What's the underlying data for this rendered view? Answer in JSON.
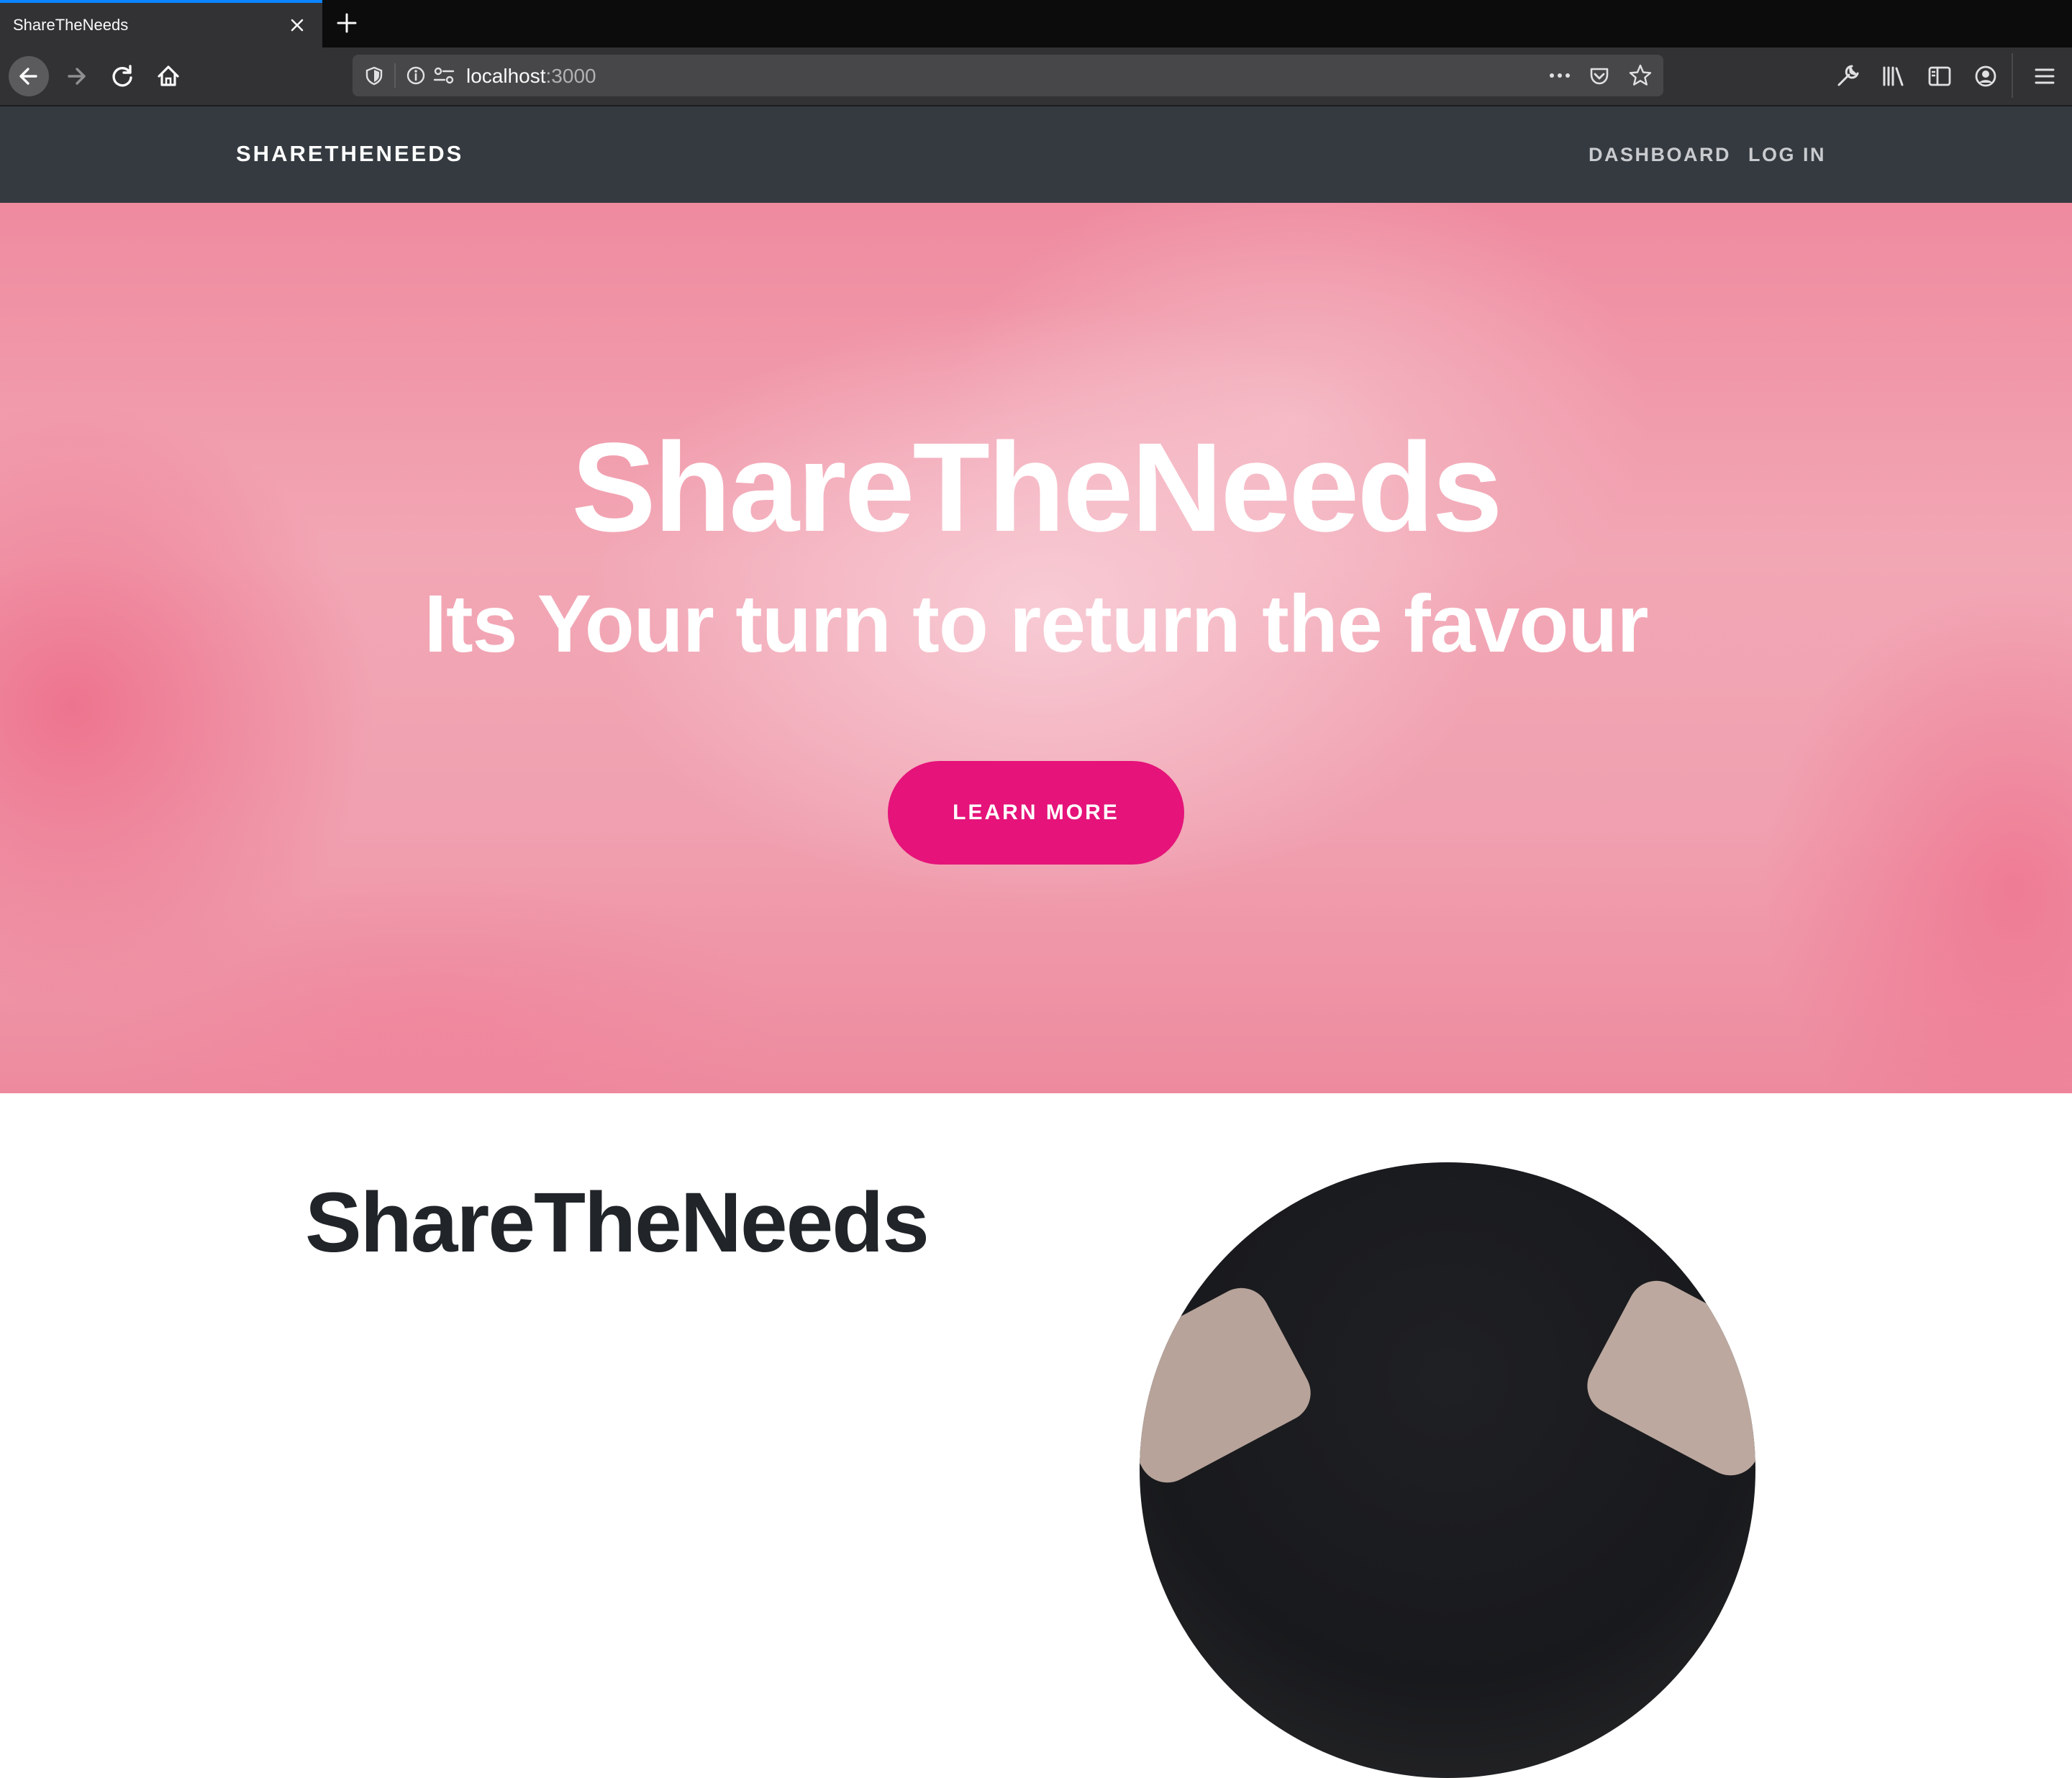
{
  "browser": {
    "tab": {
      "title": "ShareTheNeeds"
    },
    "address": {
      "host": "localhost",
      "port": ":3000"
    }
  },
  "site": {
    "brand": "SHARETHENEEDS",
    "nav": [
      {
        "label": "DASHBOARD"
      },
      {
        "label": "LOG IN"
      }
    ]
  },
  "hero": {
    "title": "ShareTheNeeds",
    "subtitle": "Its Your turn to return the favour",
    "button": "LEARN MORE"
  },
  "about": {
    "title": "ShareTheNeeds"
  },
  "colors": {
    "accent": "#e5137a",
    "nav_bg": "#343a40",
    "browser_tab_highlight": "#0a84ff"
  }
}
